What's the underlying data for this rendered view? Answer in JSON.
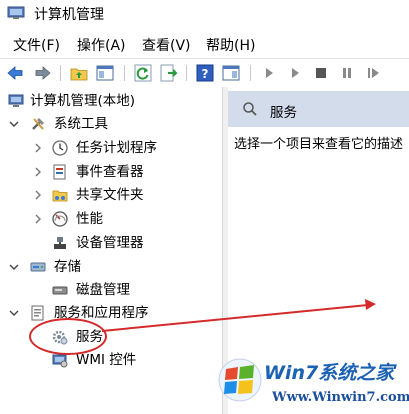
{
  "window": {
    "title": "计算机管理"
  },
  "menu": {
    "file": "文件(F)",
    "action": "操作(A)",
    "view": "查看(V)",
    "help": "帮助(H)"
  },
  "tree": {
    "root": "计算机管理(本地)",
    "system_tools": "系统工具",
    "task_scheduler": "任务计划程序",
    "event_viewer": "事件查看器",
    "shared_folders": "共享文件夹",
    "performance": "性能",
    "device_manager": "设备管理器",
    "storage": "存储",
    "disk_management": "磁盘管理",
    "services_apps": "服务和应用程序",
    "services": "服务",
    "wmi": "WMI 控件"
  },
  "panel": {
    "title": "服务",
    "description": "选择一个项目来查看它的描述"
  },
  "watermark": {
    "brand": "Win7系统之家",
    "url": "Www.Winwin7.com"
  },
  "colors": {
    "panel_header": "#d3dcea",
    "annotation": "#d42a2a",
    "watermark": "#1b62b3"
  }
}
